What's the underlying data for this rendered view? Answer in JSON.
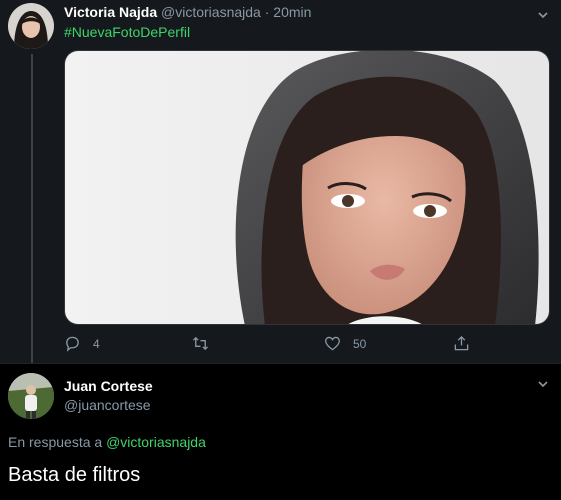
{
  "tweet": {
    "author_name": "Victoria Najda",
    "author_handle": "@victoriasnajda",
    "separator": "·",
    "time": "20min",
    "hashtag": "#NuevaFotoDePerfil",
    "media_icon": "profile-photo-selfie",
    "stats": {
      "replies": "4",
      "retweets": "",
      "likes": "50"
    }
  },
  "reply": {
    "author_name": "Juan Cortese",
    "author_handle": "@juancortese",
    "reply_prefix": "En respuesta a",
    "reply_mention": "@victoriasnajda",
    "text": "Basta de filtros"
  },
  "colors": {
    "accent": "#3ed46a",
    "muted": "#8899a6",
    "tweet_bg": "#15181c",
    "page_bg": "#000000"
  }
}
